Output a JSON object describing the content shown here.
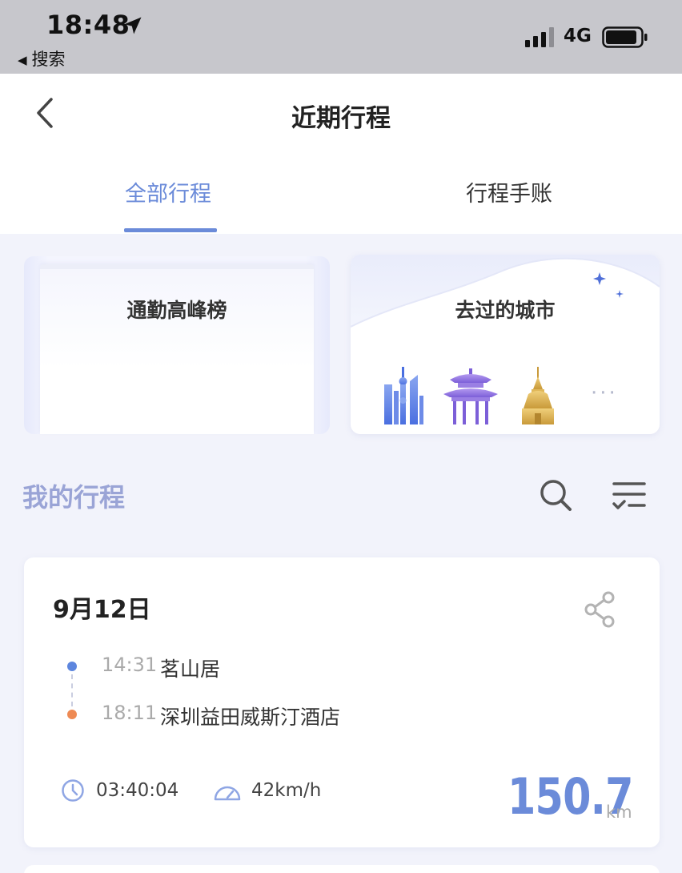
{
  "status_bar": {
    "time": "18:48",
    "back_app": "搜索",
    "network": "4G"
  },
  "nav": {
    "title": "近期行程"
  },
  "tabs": [
    {
      "label": "全部行程",
      "active": true
    },
    {
      "label": "行程手账",
      "active": false
    }
  ],
  "cards": {
    "peak_label": "通勤高峰榜",
    "cities_label": "去过的城市",
    "more": "···"
  },
  "section": {
    "title": "我的行程"
  },
  "trip": {
    "date": "9月12日",
    "start": {
      "time": "14:31",
      "place": "茗山居"
    },
    "end": {
      "time": "18:11",
      "place": "深圳益田威斯汀酒店"
    },
    "duration": "03:40:04",
    "speed": "42km/h",
    "distance": "150.7",
    "unit": "km"
  },
  "colors": {
    "accent": "#6b8bd9",
    "start_dot": "#5d86de",
    "end_dot": "#ee8a54",
    "section_title": "#9aa4d6",
    "page_bg": "#f2f3fb"
  }
}
